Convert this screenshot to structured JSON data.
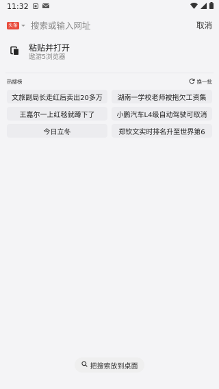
{
  "status": {
    "time": "11:32"
  },
  "search": {
    "app_badge": "头条",
    "placeholder": "搜索或输入网址",
    "cancel_label": "取消"
  },
  "paste": {
    "title": "粘贴并打开",
    "subtitle": "遨游5浏览器"
  },
  "hot": {
    "title": "热搜榜",
    "refresh_label": "换一批",
    "items": [
      "文旅副局长走红后卖出20多万",
      "湖南一学校老师被拖欠工资集",
      "王嘉尔一上红毯就蹲下了",
      "小鹏汽车L4级自动驾驶可取消",
      "今日立冬",
      "郑钦文实时排名升至世界第6"
    ]
  },
  "bottom": {
    "label": "把搜索放到桌面"
  },
  "colors": {
    "badge_red": "#e84a3a",
    "background": "#f4f4f6"
  }
}
